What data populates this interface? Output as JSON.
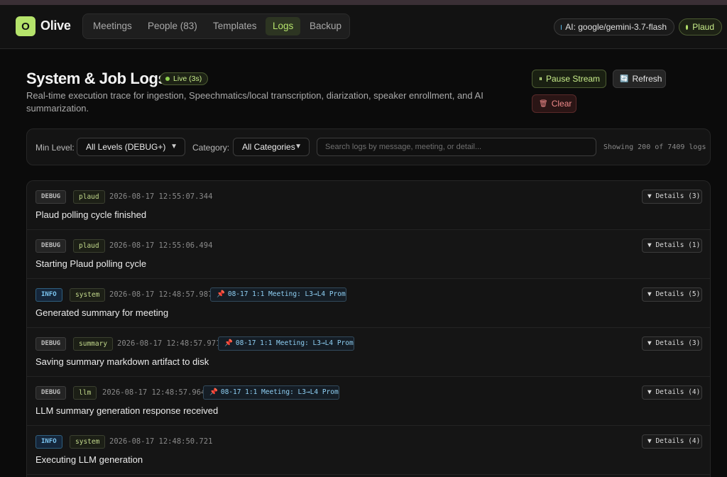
{
  "app": {
    "logo_letter": "O",
    "name": "Olive"
  },
  "nav": {
    "tabs": [
      {
        "label": "Meetings"
      },
      {
        "label": "People (83)"
      },
      {
        "label": "Templates"
      },
      {
        "label": "Logs"
      },
      {
        "label": "Backup"
      }
    ],
    "active": "Logs"
  },
  "status": {
    "ai": "AI: google/gemini-3.7-flash",
    "plaud": "Plaud"
  },
  "page": {
    "title": "System & Job Logs",
    "live_badge": "Live (3s)",
    "subtitle": "Real-time execution trace for ingestion, Speechmatics/local transcription, diarization, speaker enrollment, and AI summarization."
  },
  "actions": {
    "pause": {
      "icon": "⏸",
      "label": "Pause Stream"
    },
    "refresh": {
      "icon": "🔄",
      "label": "Refresh"
    },
    "clear": {
      "icon": "🗑",
      "label": "Clear"
    }
  },
  "filters": {
    "min_level_label": "Min Level:",
    "min_level_value": "All Levels (DEBUG+)",
    "category_label": "Category:",
    "category_value": "All Categories",
    "search_placeholder": "Search logs by message, meeting, or detail...",
    "showing": "Showing 200 of 7409 logs"
  },
  "logs": [
    {
      "level": "DEBUG",
      "category": "plaud",
      "timestamp": "2026-08-17 12:55:07.344",
      "meeting": "",
      "message": "Plaud polling cycle finished",
      "details": "▼ Details (3)"
    },
    {
      "level": "DEBUG",
      "category": "plaud",
      "timestamp": "2026-08-17 12:55:06.494",
      "meeting": "",
      "message": "Starting Plaud polling cycle",
      "details": "▼ Details (1)"
    },
    {
      "level": "INFO",
      "category": "system",
      "timestamp": "2026-08-17 12:48:57.987",
      "meeting": "08-17 1:1 Meeting: L3→L4 Prom…",
      "message": "Generated summary for meeting",
      "details": "▼ Details (5)"
    },
    {
      "level": "DEBUG",
      "category": "summary",
      "timestamp": "2026-08-17 12:48:57.971",
      "meeting": "08-17 1:1 Meeting: L3→L4 Prom…",
      "message": "Saving summary markdown artifact to disk",
      "details": "▼ Details (3)"
    },
    {
      "level": "DEBUG",
      "category": "llm",
      "timestamp": "2026-08-17 12:48:57.964",
      "meeting": "08-17 1:1 Meeting: L3→L4 Prom…",
      "message": "LLM summary generation response received",
      "details": "▼ Details (4)"
    },
    {
      "level": "INFO",
      "category": "system",
      "timestamp": "2026-08-17 12:48:50.721",
      "meeting": "",
      "message": "Executing LLM generation",
      "details": "▼ Details (4)"
    }
  ]
}
